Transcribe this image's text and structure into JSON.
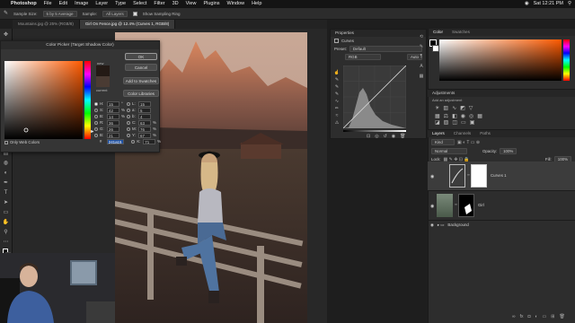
{
  "menubar": {
    "app": "Photoshop",
    "items": [
      "File",
      "Edit",
      "Image",
      "Layer",
      "Type",
      "Select",
      "Filter",
      "3D",
      "View",
      "Plugins",
      "Window",
      "Help"
    ],
    "center": "Adobe Photoshop 2021",
    "right": "Sat 12:21 PM"
  },
  "options": {
    "sample_size": "Sample Size:",
    "sample_val": "5 by 5 Average",
    "sample_label": "Sample:",
    "sample": "All Layers",
    "ring": "Show Sampling Ring"
  },
  "tabs": [
    "Mountains.jpg @ 25% (RGB/8)",
    "Girl On Fence.jpg @ 12.4% (Curves 1, RGB/8)"
  ],
  "picker": {
    "title": "Color Picker (Target Shadow Color)",
    "new": "new",
    "current": "current",
    "ok": "OK",
    "cancel": "Cancel",
    "add": "Add to Swatches",
    "libs": "Color Libraries",
    "only_web": "Only Web Colors",
    "fields": [
      {
        "k": "H:",
        "v": "15",
        "u": "°",
        "k2": "L:",
        "v2": "15"
      },
      {
        "k": "S:",
        "v": "42",
        "u": "%",
        "k2": "a:",
        "v2": "5"
      },
      {
        "k": "B:",
        "v": "14",
        "u": "%",
        "k2": "b:",
        "v2": "4"
      },
      {
        "k": "R:",
        "v": "36",
        "u": "",
        "k2": "C:",
        "v2": "63",
        "u2": "%"
      },
      {
        "k": "G:",
        "v": "26",
        "u": "",
        "k2": "M:",
        "v2": "76",
        "u2": "%"
      },
      {
        "k": "B:",
        "v": "21",
        "u": "",
        "k2": "Y:",
        "v2": "67",
        "u2": "%"
      },
      {
        "k": "#",
        "v": "241a15",
        "u": "",
        "k2": "K:",
        "v2": "71",
        "u2": "%"
      }
    ],
    "new_color": "#241a15",
    "current_color": "#4a3b33"
  },
  "properties": {
    "title": "Properties",
    "sub": "Curves",
    "preset_label": "Preset:",
    "preset": "Default",
    "channel": "RGB",
    "auto": "Auto"
  },
  "color": {
    "tab1": "Color",
    "tab2": "Swatches"
  },
  "adjustments": {
    "title": "Adjustments",
    "sub": "Add an adjustment"
  },
  "layers": {
    "tabs": [
      "Layers",
      "Channels",
      "Paths"
    ],
    "kind": "Kind",
    "mode": "Normal",
    "opacity_label": "Opacity:",
    "opacity": "100%",
    "lock": "Lock:",
    "fill_label": "Fill:",
    "fill": "100%",
    "items": [
      {
        "name": "Curves 1"
      },
      {
        "name": "Girl"
      },
      {
        "name": "Background"
      }
    ]
  }
}
